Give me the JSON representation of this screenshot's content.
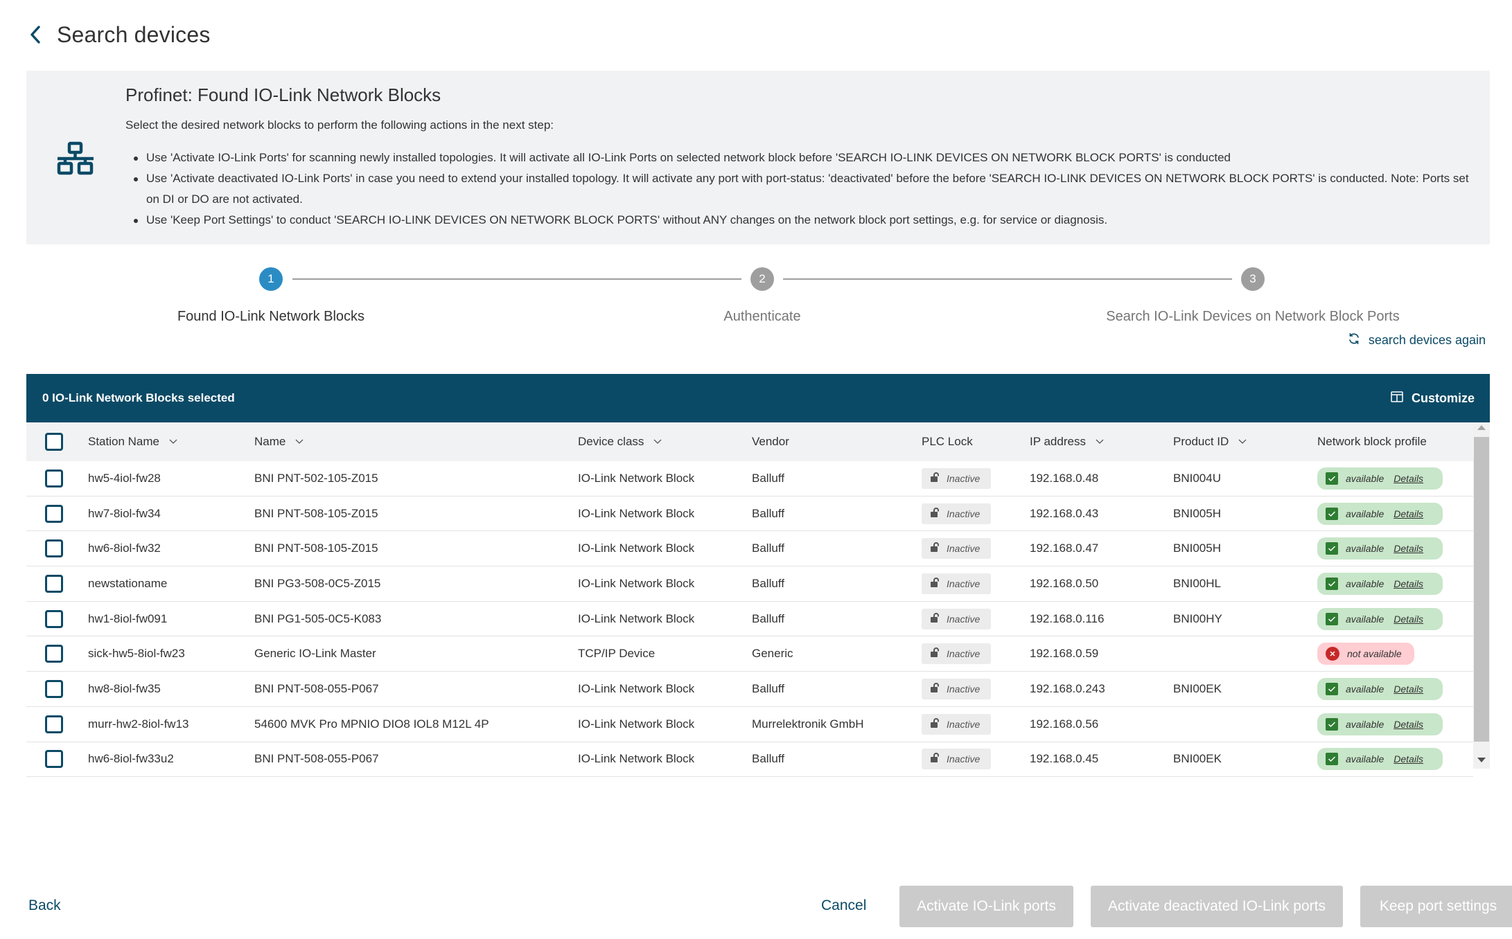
{
  "header": {
    "title": "Search devices",
    "back_icon": "chevron-left-icon"
  },
  "info": {
    "icon": "network-icon",
    "title": "Profinet: Found IO-Link Network Blocks",
    "subtitle": "Select the desired network blocks to perform the following actions in the next step:",
    "bullets": [
      "Use 'Activate IO-Link Ports' for scanning newly installed topologies. It will activate all IO-Link Ports on selected network block before 'SEARCH IO-LINK DEVICES ON NETWORK BLOCK PORTS' is conducted",
      "Use 'Activate deactivated IO-Link Ports' in case you need to extend your installed topology. It will activate any port with port-status: 'deactivated' before the before 'SEARCH IO-LINK DEVICES ON NETWORK BLOCK PORTS' is conducted. Note: Ports set on DI or DO are not activated.",
      "Use 'Keep Port Settings' to conduct 'SEARCH IO-LINK DEVICES ON NETWORK BLOCK PORTS' without ANY changes on the network block port settings, e.g. for service or diagnosis."
    ]
  },
  "stepper": {
    "steps": [
      {
        "number": "1",
        "label": "Found IO-Link Network Blocks",
        "state": "active"
      },
      {
        "number": "2",
        "label": "Authenticate",
        "state": "inactive"
      },
      {
        "number": "3",
        "label": "Search IO-Link Devices on Network Block Ports",
        "state": "inactive"
      }
    ],
    "search_again_label": "search devices again",
    "search_again_icon": "refresh-icon"
  },
  "table": {
    "selected_label": "0 IO-Link Network Blocks selected",
    "customize_label": "Customize",
    "customize_icon": "columns-icon",
    "columns": {
      "station": "Station Name",
      "name": "Name",
      "device_class": "Device class",
      "vendor": "Vendor",
      "plc_lock": "PLC Lock",
      "ip": "IP address",
      "product_id": "Product ID",
      "profile": "Network block profile"
    },
    "rows": [
      {
        "station": "hw5-4iol-fw28",
        "name": "BNI PNT-502-105-Z015",
        "device_class": "IO-Link Network Block",
        "vendor": "Balluff",
        "plc_lock": "Inactive",
        "ip": "192.168.0.48",
        "product_id": "BNI004U",
        "profile": "available",
        "profile_ok": true,
        "details": "Details"
      },
      {
        "station": "hw7-8iol-fw34",
        "name": "BNI PNT-508-105-Z015",
        "device_class": "IO-Link Network Block",
        "vendor": "Balluff",
        "plc_lock": "Inactive",
        "ip": "192.168.0.43",
        "product_id": "BNI005H",
        "profile": "available",
        "profile_ok": true,
        "details": "Details"
      },
      {
        "station": "hw6-8iol-fw32",
        "name": "BNI PNT-508-105-Z015",
        "device_class": "IO-Link Network Block",
        "vendor": "Balluff",
        "plc_lock": "Inactive",
        "ip": "192.168.0.47",
        "product_id": "BNI005H",
        "profile": "available",
        "profile_ok": true,
        "details": "Details"
      },
      {
        "station": "newstationame",
        "name": "BNI PG3-508-0C5-Z015",
        "device_class": "IO-Link Network Block",
        "vendor": "Balluff",
        "plc_lock": "Inactive",
        "ip": "192.168.0.50",
        "product_id": "BNI00HL",
        "profile": "available",
        "profile_ok": true,
        "details": "Details"
      },
      {
        "station": "hw1-8iol-fw091",
        "name": "BNI PG1-505-0C5-K083",
        "device_class": "IO-Link Network Block",
        "vendor": "Balluff",
        "plc_lock": "Inactive",
        "ip": "192.168.0.116",
        "product_id": "BNI00HY",
        "profile": "available",
        "profile_ok": true,
        "details": "Details"
      },
      {
        "station": "sick-hw5-8iol-fw23",
        "name": "Generic IO-Link Master",
        "device_class": "TCP/IP Device",
        "vendor": "Generic",
        "plc_lock": "Inactive",
        "ip": "192.168.0.59",
        "product_id": "",
        "profile": "not available",
        "profile_ok": false,
        "details": ""
      },
      {
        "station": "hw8-8iol-fw35",
        "name": "BNI PNT-508-055-P067",
        "device_class": "IO-Link Network Block",
        "vendor": "Balluff",
        "plc_lock": "Inactive",
        "ip": "192.168.0.243",
        "product_id": "BNI00EK",
        "profile": "available",
        "profile_ok": true,
        "details": "Details"
      },
      {
        "station": "murr-hw2-8iol-fw13",
        "name": "54600 MVK Pro MPNIO DIO8 IOL8 M12L 4P",
        "device_class": "IO-Link Network Block",
        "vendor": "Murrelektronik GmbH",
        "plc_lock": "Inactive",
        "ip": "192.168.0.56",
        "product_id": "",
        "profile": "available",
        "profile_ok": true,
        "details": "Details"
      },
      {
        "station": "hw6-8iol-fw33u2",
        "name": "BNI PNT-508-055-P067",
        "device_class": "IO-Link Network Block",
        "vendor": "Balluff",
        "plc_lock": "Inactive",
        "ip": "192.168.0.45",
        "product_id": "BNI00EK",
        "profile": "available",
        "profile_ok": true,
        "details": "Details"
      }
    ]
  },
  "footer": {
    "back_label": "Back",
    "cancel_label": "Cancel",
    "activate_label": "Activate IO-Link ports",
    "activate_deactivated_label": "Activate deactivated IO-Link ports",
    "keep_label": "Keep port settings"
  },
  "colors": {
    "primary": "#0b4a66",
    "step_active": "#2b8cc4",
    "step_inactive": "#9e9e9e",
    "available_bg": "#c8e6c9",
    "available_icon": "#2e7d32",
    "not_available_bg": "#ffcdd2",
    "not_available_icon": "#c62828",
    "disabled_button": "#cbcbcb",
    "info_bg": "#f1f2f4"
  }
}
